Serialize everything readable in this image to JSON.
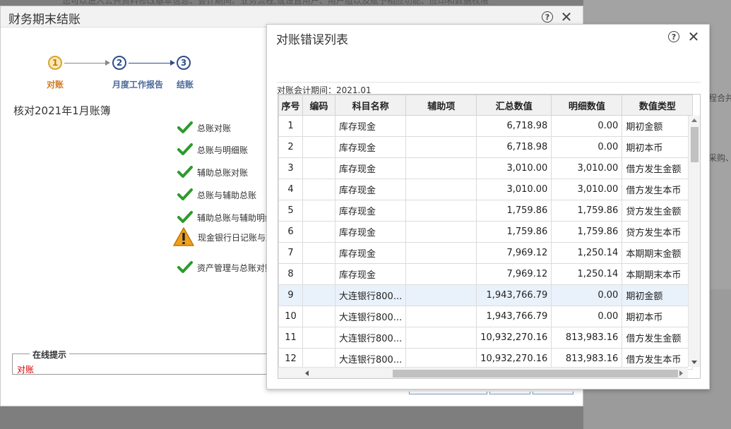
{
  "background": {
    "top_text": "您可以进入公共资料修改基本信息、会计期间、业务流程,或设置用户、用户组以及赋予相应功能、应印和数据权限",
    "right_text_1": "程合并",
    "right_text_2": "采购、"
  },
  "main_dialog": {
    "title": "财务期末结账",
    "steps": [
      {
        "num": "1",
        "label": "对账"
      },
      {
        "num": "2",
        "label": "月度工作报告"
      },
      {
        "num": "3",
        "label": "结账"
      }
    ],
    "check_title": "核对2021年1月账簿",
    "check_items": [
      {
        "label": "总账对账",
        "status": "ok"
      },
      {
        "label": "总账与明细账",
        "status": "ok"
      },
      {
        "label": "辅助总账对账",
        "status": "ok"
      },
      {
        "label": "总账与辅助总账",
        "status": "ok"
      },
      {
        "label": "辅助总账与辅助明细",
        "status": "ok"
      },
      {
        "label": "现金银行日记账与总",
        "status": "warning"
      },
      {
        "label": "资产管理与总账对账",
        "status": "ok"
      }
    ],
    "tip": {
      "legend": "在线提示",
      "text": "对账"
    }
  },
  "error_dialog": {
    "title": "对账错误列表",
    "period_label": "对账会计期间：2021.01",
    "columns": [
      "序号",
      "编码",
      "科目名称",
      "辅助项",
      "汇总数值",
      "明细数值",
      "数值类型"
    ],
    "rows": [
      {
        "no": "1",
        "code": "",
        "name": "库存现金",
        "aux": "",
        "summary": "6,718.98",
        "detail": "0.00",
        "type": "期初金额"
      },
      {
        "no": "2",
        "code": "",
        "name": "库存现金",
        "aux": "",
        "summary": "6,718.98",
        "detail": "0.00",
        "type": "期初本币"
      },
      {
        "no": "3",
        "code": "",
        "name": "库存现金",
        "aux": "",
        "summary": "3,010.00",
        "detail": "3,010.00",
        "type": "借方发生金额"
      },
      {
        "no": "4",
        "code": "",
        "name": "库存现金",
        "aux": "",
        "summary": "3,010.00",
        "detail": "3,010.00",
        "type": "借方发生本币"
      },
      {
        "no": "5",
        "code": "",
        "name": "库存现金",
        "aux": "",
        "summary": "1,759.86",
        "detail": "1,759.86",
        "type": "贷方发生金额"
      },
      {
        "no": "6",
        "code": "",
        "name": "库存现金",
        "aux": "",
        "summary": "1,759.86",
        "detail": "1,759.86",
        "type": "贷方发生本币"
      },
      {
        "no": "7",
        "code": "",
        "name": "库存现金",
        "aux": "",
        "summary": "7,969.12",
        "detail": "1,250.14",
        "type": "本期期末金额"
      },
      {
        "no": "8",
        "code": "",
        "name": "库存现金",
        "aux": "",
        "summary": "7,969.12",
        "detail": "1,250.14",
        "type": "本期期末本币"
      },
      {
        "no": "9",
        "code": "",
        "name": "大连银行800...",
        "aux": "",
        "summary": "1,943,766.79",
        "detail": "0.00",
        "type": "期初金额"
      },
      {
        "no": "10",
        "code": "",
        "name": "大连银行800...",
        "aux": "",
        "summary": "1,943,766.79",
        "detail": "0.00",
        "type": "期初本币"
      },
      {
        "no": "11",
        "code": "",
        "name": "大连银行800...",
        "aux": "",
        "summary": "10,932,270.16",
        "detail": "813,983.16",
        "type": "借方发生金额"
      },
      {
        "no": "12",
        "code": "",
        "name": "大连银行800...",
        "aux": "",
        "summary": "10,932,270.16",
        "detail": "813,983.16",
        "type": "借方发生本币"
      }
    ],
    "highlighted_row": 9
  }
}
